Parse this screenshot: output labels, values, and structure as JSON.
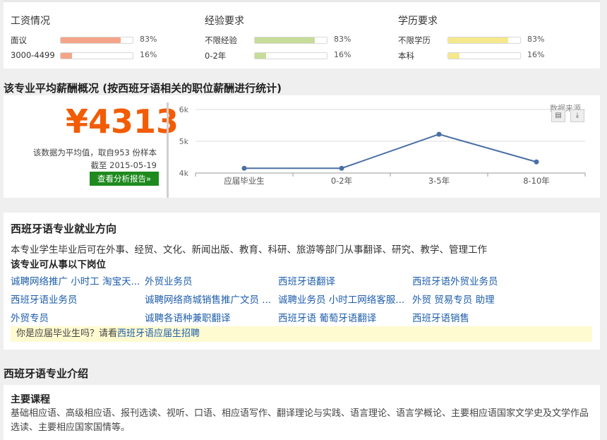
{
  "stats": [
    {
      "title": "工资情况",
      "rows": [
        {
          "label": "面议",
          "pct": "83%",
          "fill": 0.83,
          "color": "#f4a488"
        },
        {
          "label": "3000-4499",
          "pct": "16%",
          "fill": 0.16,
          "color": "#f4a488"
        }
      ]
    },
    {
      "title": "经验要求",
      "rows": [
        {
          "label": "不限经验",
          "pct": "83%",
          "fill": 0.83,
          "color": "#c6dc98"
        },
        {
          "label": "0-2年",
          "pct": "16%",
          "fill": 0.16,
          "color": "#c6dc98"
        }
      ]
    },
    {
      "title": "学历要求",
      "rows": [
        {
          "label": "不限学历",
          "pct": "83%",
          "fill": 0.83,
          "color": "#f6e88c"
        },
        {
          "label": "本科",
          "pct": "16%",
          "fill": 0.16,
          "color": "#f6e88c"
        }
      ]
    }
  ],
  "salary": {
    "section_title": "该专业平均薪酬概况 (按西班牙语相关的职位薪酬进行统计)",
    "amount": "¥4313",
    "note_line1": "该数据为平均值，取自953 份样本",
    "note_line2": "截至 2015-05-19",
    "report_button": "查看分析报告»",
    "data_source": "数据来源"
  },
  "chart_data": {
    "type": "line",
    "categories": [
      "应届毕业生",
      "0-2年",
      "3-5年",
      "8-10年"
    ],
    "values": [
      4150,
      4150,
      5220,
      4350
    ],
    "ylim": [
      4000,
      6000
    ],
    "yticks": [
      "4k",
      "5k",
      "6k"
    ],
    "grid": true,
    "line_color": "#4a6fa5"
  },
  "career": {
    "title": "西班牙语专业就业方向",
    "description": "本专业学生毕业后可在外事、经贸、文化、新闻出版、教育、科研、旅游等部门从事翻译、研究、教学、管理工作",
    "subtitle": "该专业可从事以下岗位",
    "jobs": [
      "诚聘网络推广 小时工 淘宝天...",
      "外贸业务员",
      "西班牙语翻译",
      "西班牙语外贸业务员",
      "西班牙语业务员",
      "诚聘网络商城销售推广文员 ...",
      "诚聘业务员 小时工网络客服...",
      "外贸 贸易专员 助理",
      "外贸专员",
      "诚聘各语种兼职翻译",
      "西班牙语 葡萄牙语翻译",
      "西班牙语销售"
    ],
    "notice_prefix": "你是应届毕业生吗？请看",
    "notice_link": "西班牙语应届生招聘"
  },
  "intro": {
    "section_title": "西班牙语专业介绍",
    "head": "主要课程",
    "text": "基础相应语、高级相应语、报刊选读、视听、口语、相应语写作、翻译理论与实践、语言理论、语言学概论、主要相应语国家文学史及文学作品选读、主要相应国家国情等。"
  }
}
